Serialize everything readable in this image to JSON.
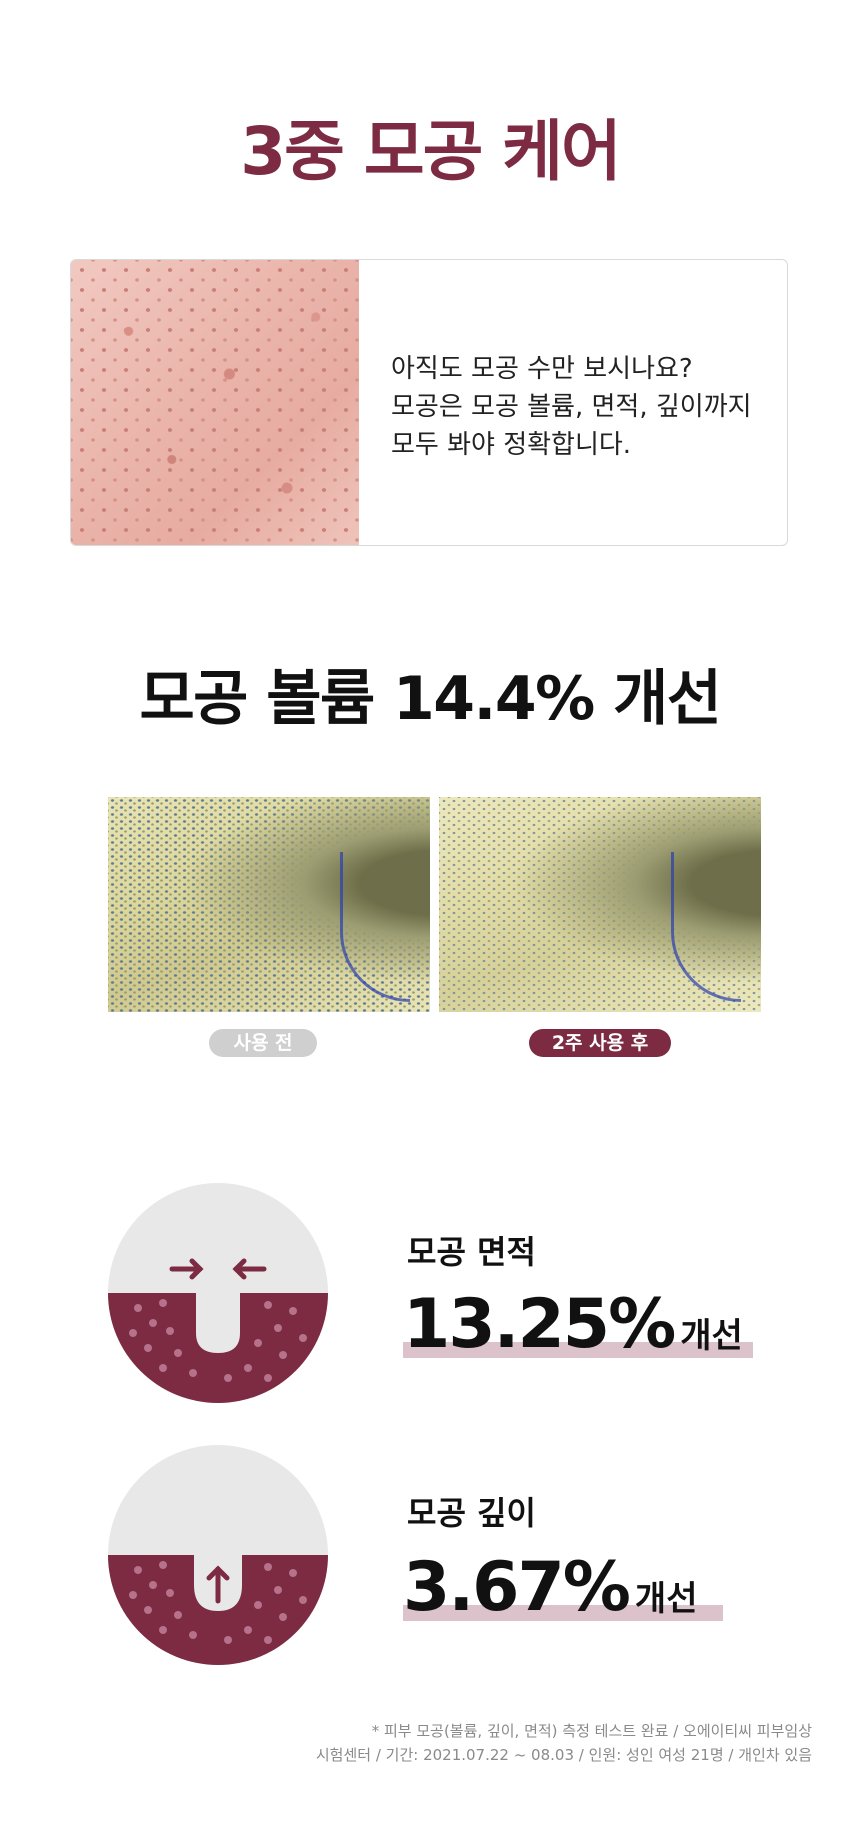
{
  "title": "3중 모공 케어",
  "intro": {
    "lines": [
      "아직도 모공 수만 보시나요?",
      "모공은 모공 볼륨, 면적, 깊이까지",
      "모두 봐야 정확합니다."
    ]
  },
  "headline": "모공 볼륨 14.4% 개선",
  "comparison": {
    "before_label": "사용 전",
    "after_label": "2주 사용 후"
  },
  "stats": [
    {
      "label": "모공 면적",
      "value": "13.25%",
      "unit": "개선",
      "icon": "pore-shrink-icon"
    },
    {
      "label": "모공 깊이",
      "value": "3.67%",
      "unit": "개선",
      "icon": "pore-lift-icon"
    }
  ],
  "colors": {
    "accent": "#7c2b42",
    "highlight": "#dcc2cb",
    "circle_bg": "#e8e8e8",
    "dots": "#b5728a"
  },
  "footnote": {
    "lines": [
      "* 피부 모공(볼륨, 깊이, 면적) 측정 테스트 완료 / 오에이티씨 피부임상",
      "시험센터 / 기간: 2021.07.22 ~ 08.03 / 인원: 성인 여성 21명 / 개인차 있음"
    ]
  }
}
